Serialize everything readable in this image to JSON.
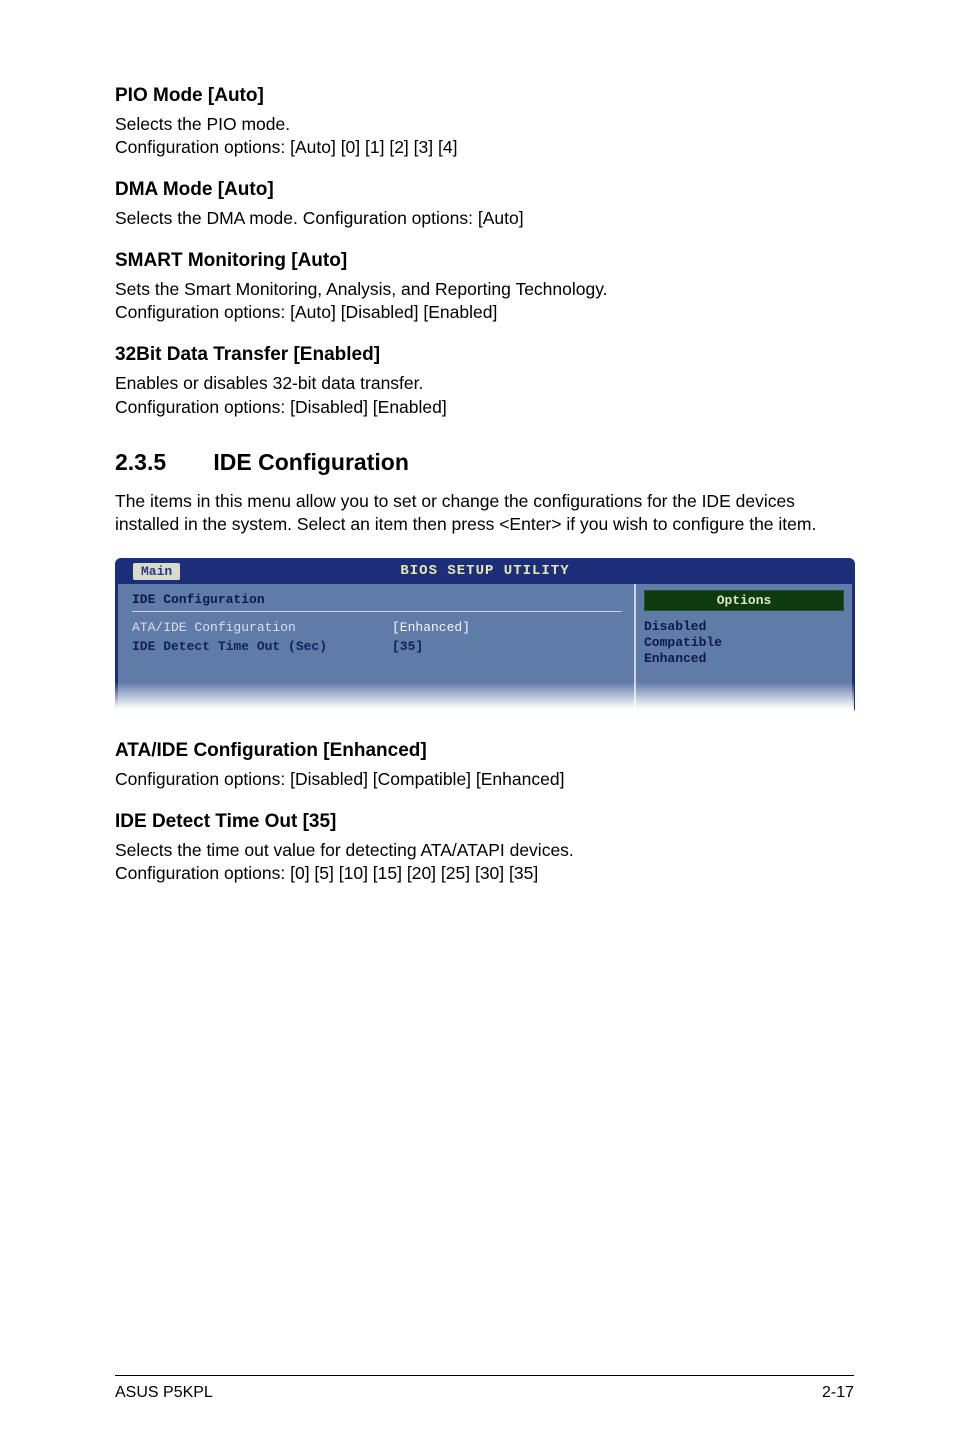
{
  "sections": {
    "pio": {
      "heading": "PIO Mode [Auto]",
      "line1": "Selects the PIO mode.",
      "line2": "Configuration options: [Auto] [0] [1] [2] [3] [4]"
    },
    "dma": {
      "heading": "DMA Mode [Auto]",
      "line1": "Selects the DMA mode. Configuration options: [Auto]"
    },
    "smart": {
      "heading": "SMART Monitoring [Auto]",
      "line1": "Sets the Smart Monitoring, Analysis, and Reporting Technology.",
      "line2": "Configuration options: [Auto] [Disabled] [Enabled]"
    },
    "bit32": {
      "heading": "32Bit Data Transfer [Enabled]",
      "line1": "Enables or disables 32-bit data transfer.",
      "line2": "Configuration options: [Disabled] [Enabled]"
    },
    "idecfg": {
      "number": "2.3.5",
      "title": "IDE Configuration",
      "desc": "The items in this menu allow you to set or change the configurations for the IDE devices installed in the system. Select an item then press <Enter> if you wish to configure the item."
    },
    "ataide": {
      "heading": "ATA/IDE Configuration [Enhanced]",
      "line1": "Configuration options: [Disabled] [Compatible] [Enhanced]"
    },
    "idetime": {
      "heading": "IDE Detect Time Out [35]",
      "line1": "Selects the time out value for detecting ATA/ATAPI devices.",
      "line2": "Configuration options: [0] [5] [10] [15] [20] [25] [30] [35]"
    }
  },
  "bios": {
    "title": "BIOS SETUP UTILITY",
    "tab": "Main",
    "left_header": "IDE Configuration",
    "rows": [
      {
        "label": "ATA/IDE Configuration",
        "value": "[Enhanced]",
        "selected": true
      },
      {
        "label": "IDE Detect Time Out (Sec)",
        "value": "[35]",
        "selected": false
      }
    ],
    "right_title": "Options",
    "right_list": [
      "Disabled",
      "Compatible",
      "Enhanced"
    ]
  },
  "footer": {
    "left": "ASUS P5KPL",
    "right": "2-17"
  }
}
